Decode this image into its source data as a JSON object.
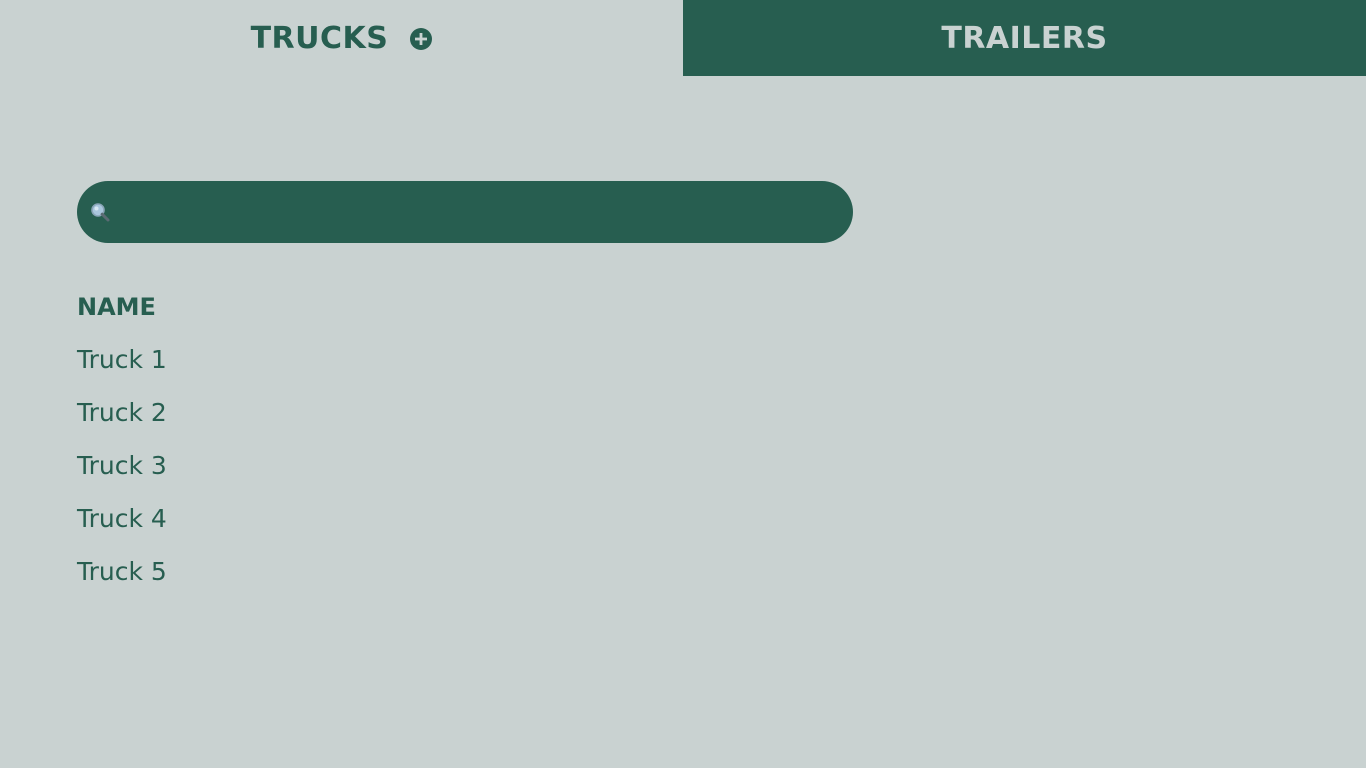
{
  "tabs": {
    "trucks_label": "TRUCKS",
    "trailers_label": "TRAILERS",
    "add_icon": "plus-circle-icon"
  },
  "search": {
    "icon": "magnifier-icon",
    "value": "",
    "placeholder": ""
  },
  "list": {
    "column_header": "NAME",
    "items": [
      {
        "name": "Truck 1"
      },
      {
        "name": "Truck 2"
      },
      {
        "name": "Truck 3"
      },
      {
        "name": "Truck 4"
      },
      {
        "name": "Truck 5"
      }
    ]
  },
  "colors": {
    "background": "#c9d2d1",
    "primary": "#275e50"
  }
}
